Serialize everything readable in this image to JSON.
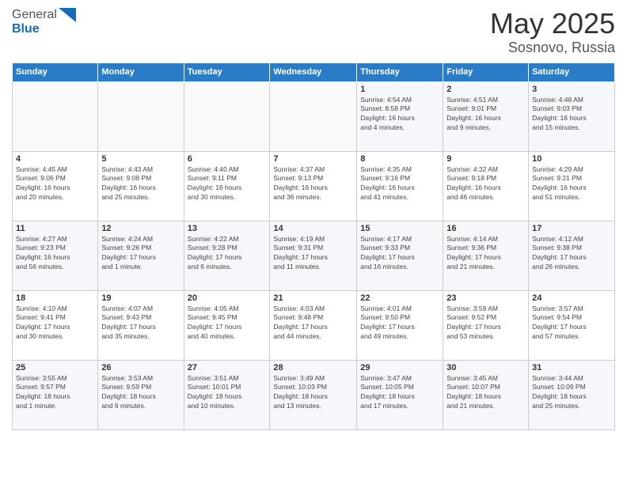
{
  "header": {
    "logo_general": "General",
    "logo_blue": "Blue",
    "title": "May 2025",
    "location": "Sosnovo, Russia"
  },
  "days_of_week": [
    "Sunday",
    "Monday",
    "Tuesday",
    "Wednesday",
    "Thursday",
    "Friday",
    "Saturday"
  ],
  "weeks": [
    [
      {
        "day": "",
        "info": ""
      },
      {
        "day": "",
        "info": ""
      },
      {
        "day": "",
        "info": ""
      },
      {
        "day": "",
        "info": ""
      },
      {
        "day": "1",
        "info": "Sunrise: 4:54 AM\nSunset: 8:58 PM\nDaylight: 16 hours\nand 4 minutes."
      },
      {
        "day": "2",
        "info": "Sunrise: 4:51 AM\nSunset: 9:01 PM\nDaylight: 16 hours\nand 9 minutes."
      },
      {
        "day": "3",
        "info": "Sunrise: 4:48 AM\nSunset: 9:03 PM\nDaylight: 16 hours\nand 15 minutes."
      }
    ],
    [
      {
        "day": "4",
        "info": "Sunrise: 4:45 AM\nSunset: 9:06 PM\nDaylight: 16 hours\nand 20 minutes."
      },
      {
        "day": "5",
        "info": "Sunrise: 4:43 AM\nSunset: 9:08 PM\nDaylight: 16 hours\nand 25 minutes."
      },
      {
        "day": "6",
        "info": "Sunrise: 4:40 AM\nSunset: 9:11 PM\nDaylight: 16 hours\nand 30 minutes."
      },
      {
        "day": "7",
        "info": "Sunrise: 4:37 AM\nSunset: 9:13 PM\nDaylight: 16 hours\nand 36 minutes."
      },
      {
        "day": "8",
        "info": "Sunrise: 4:35 AM\nSunset: 9:16 PM\nDaylight: 16 hours\nand 41 minutes."
      },
      {
        "day": "9",
        "info": "Sunrise: 4:32 AM\nSunset: 9:18 PM\nDaylight: 16 hours\nand 46 minutes."
      },
      {
        "day": "10",
        "info": "Sunrise: 4:29 AM\nSunset: 9:21 PM\nDaylight: 16 hours\nand 51 minutes."
      }
    ],
    [
      {
        "day": "11",
        "info": "Sunrise: 4:27 AM\nSunset: 9:23 PM\nDaylight: 16 hours\nand 56 minutes."
      },
      {
        "day": "12",
        "info": "Sunrise: 4:24 AM\nSunset: 9:26 PM\nDaylight: 17 hours\nand 1 minute."
      },
      {
        "day": "13",
        "info": "Sunrise: 4:22 AM\nSunset: 9:28 PM\nDaylight: 17 hours\nand 6 minutes."
      },
      {
        "day": "14",
        "info": "Sunrise: 4:19 AM\nSunset: 9:31 PM\nDaylight: 17 hours\nand 11 minutes."
      },
      {
        "day": "15",
        "info": "Sunrise: 4:17 AM\nSunset: 9:33 PM\nDaylight: 17 hours\nand 16 minutes."
      },
      {
        "day": "16",
        "info": "Sunrise: 4:14 AM\nSunset: 9:36 PM\nDaylight: 17 hours\nand 21 minutes."
      },
      {
        "day": "17",
        "info": "Sunrise: 4:12 AM\nSunset: 9:38 PM\nDaylight: 17 hours\nand 26 minutes."
      }
    ],
    [
      {
        "day": "18",
        "info": "Sunrise: 4:10 AM\nSunset: 9:41 PM\nDaylight: 17 hours\nand 30 minutes."
      },
      {
        "day": "19",
        "info": "Sunrise: 4:07 AM\nSunset: 9:43 PM\nDaylight: 17 hours\nand 35 minutes."
      },
      {
        "day": "20",
        "info": "Sunrise: 4:05 AM\nSunset: 9:45 PM\nDaylight: 17 hours\nand 40 minutes."
      },
      {
        "day": "21",
        "info": "Sunrise: 4:03 AM\nSunset: 9:48 PM\nDaylight: 17 hours\nand 44 minutes."
      },
      {
        "day": "22",
        "info": "Sunrise: 4:01 AM\nSunset: 9:50 PM\nDaylight: 17 hours\nand 49 minutes."
      },
      {
        "day": "23",
        "info": "Sunrise: 3:59 AM\nSunset: 9:52 PM\nDaylight: 17 hours\nand 53 minutes."
      },
      {
        "day": "24",
        "info": "Sunrise: 3:57 AM\nSunset: 9:54 PM\nDaylight: 17 hours\nand 57 minutes."
      }
    ],
    [
      {
        "day": "25",
        "info": "Sunrise: 3:55 AM\nSunset: 9:57 PM\nDaylight: 18 hours\nand 1 minute."
      },
      {
        "day": "26",
        "info": "Sunrise: 3:53 AM\nSunset: 9:59 PM\nDaylight: 18 hours\nand 6 minutes."
      },
      {
        "day": "27",
        "info": "Sunrise: 3:51 AM\nSunset: 10:01 PM\nDaylight: 18 hours\nand 10 minutes."
      },
      {
        "day": "28",
        "info": "Sunrise: 3:49 AM\nSunset: 10:03 PM\nDaylight: 18 hours\nand 13 minutes."
      },
      {
        "day": "29",
        "info": "Sunrise: 3:47 AM\nSunset: 10:05 PM\nDaylight: 18 hours\nand 17 minutes."
      },
      {
        "day": "30",
        "info": "Sunrise: 3:45 AM\nSunset: 10:07 PM\nDaylight: 18 hours\nand 21 minutes."
      },
      {
        "day": "31",
        "info": "Sunrise: 3:44 AM\nSunset: 10:09 PM\nDaylight: 18 hours\nand 25 minutes."
      }
    ]
  ]
}
